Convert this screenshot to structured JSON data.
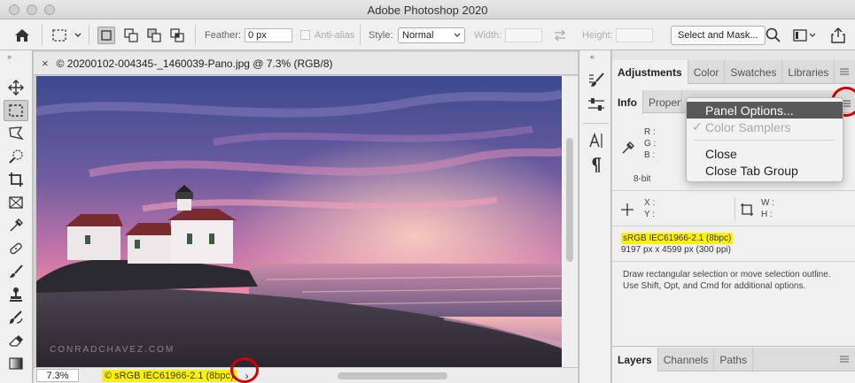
{
  "app": {
    "title": "Adobe Photoshop 2020"
  },
  "options_bar": {
    "feather_label": "Feather:",
    "feather_value": "0 px",
    "anti_alias_label": "Anti-alias",
    "style_label": "Style:",
    "style_value": "Normal",
    "width_label": "Width:",
    "height_label": "Height:",
    "select_mask_label": "Select and Mask..."
  },
  "document": {
    "tab_title": "© 20200102-004345-_1460039-Pano.jpg @ 7.3% (RGB/8)",
    "close_glyph": "×",
    "watermark": "CONRADCHAVEZ.COM",
    "zoom": "7.3%",
    "status_text": "© sRGB IEC61966-2.1 (8bpc)",
    "status_arrow": "›"
  },
  "panels": {
    "top_tabs": [
      "Adjustments",
      "Color",
      "Swatches",
      "Libraries"
    ],
    "info_tabs": [
      "Info",
      "Properties"
    ],
    "rgb_labels": [
      "R :",
      "G :",
      "B :"
    ],
    "bit_depth": "8-bit",
    "xy_labels": [
      "X :",
      "Y :"
    ],
    "wh_labels": [
      "W :",
      "H :"
    ],
    "profile": "sRGB IEC61966-2.1 (8bpc)",
    "dimensions": "9197 px x 4599 px (300 ppi)",
    "hint": "Draw rectangular selection or move selection outline.  Use Shift, Opt, and Cmd for additional options.",
    "bottom_tabs": [
      "Layers",
      "Channels",
      "Paths"
    ]
  },
  "menu": {
    "items": [
      {
        "label": "Panel Options..."
      },
      {
        "label": "Color Samplers",
        "check": "✓"
      },
      {
        "label": "Close"
      },
      {
        "label": "Close Tab Group"
      }
    ]
  },
  "colors": {
    "highlight": "#fff200",
    "callout": "#d10000",
    "menu_highlight": "#595959"
  }
}
